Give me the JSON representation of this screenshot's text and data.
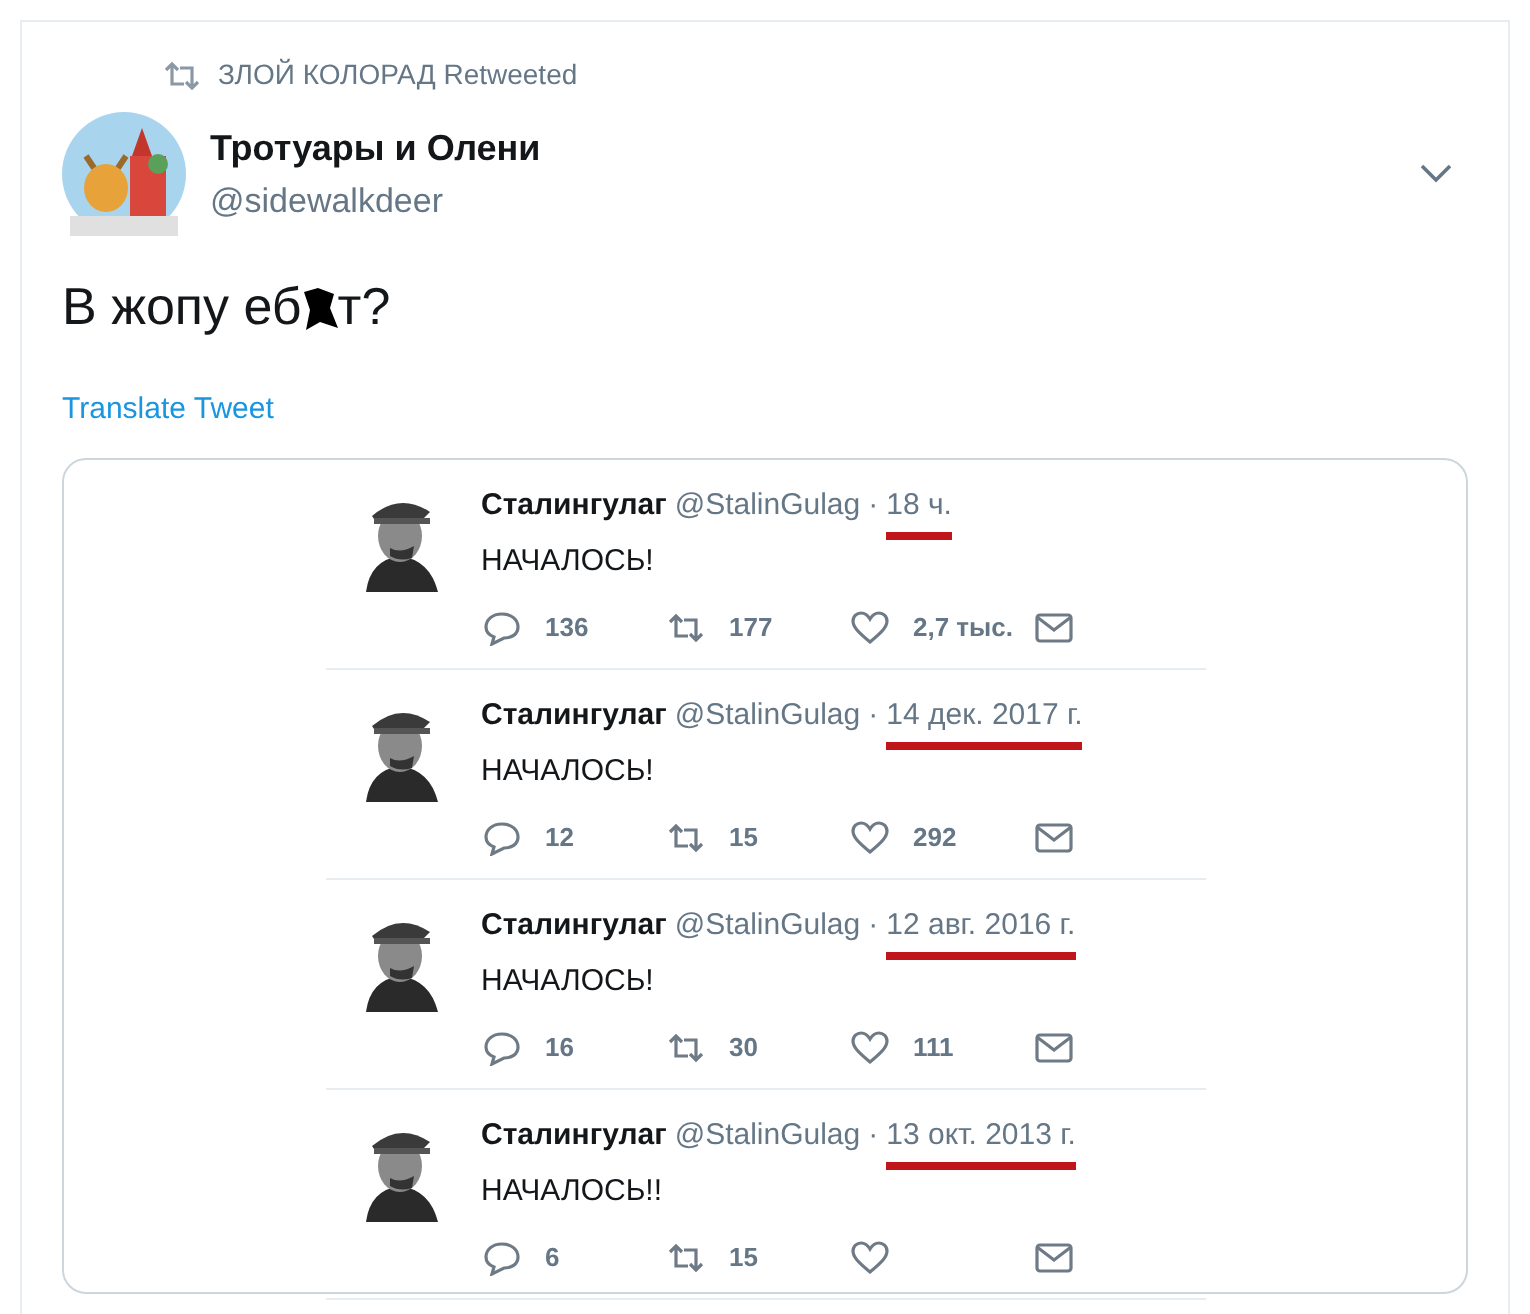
{
  "retweet_banner": {
    "text": "ЗЛОЙ КОЛОРАД Retweeted"
  },
  "author": {
    "name": "Тротуары и Олени",
    "handle": "@sidewalkdeer"
  },
  "tweet_text": {
    "before_censor": "В жопу еб",
    "after_censor": "т?"
  },
  "translate_link": "Translate Tweet",
  "quoted_tweets": [
    {
      "name": "Сталингулаг",
      "handle": "@StalinGulag",
      "separator": "·",
      "date": "18 ч.",
      "date_underlined": true,
      "text": "НАЧАЛОСЬ!",
      "replies": "136",
      "retweets": "177",
      "likes": "2,7 тыс."
    },
    {
      "name": "Сталингулаг",
      "handle": "@StalinGulag",
      "separator": "·",
      "date": "14 дек. 2017 г.",
      "date_underlined": true,
      "text": "НАЧАЛОСЬ!",
      "replies": "12",
      "retweets": "15",
      "likes": "292"
    },
    {
      "name": "Сталингулаг",
      "handle": "@StalinGulag",
      "separator": "·",
      "date": "12 авг. 2016 г.",
      "date_underlined": true,
      "text": "НАЧАЛОСЬ!",
      "replies": "16",
      "retweets": "30",
      "likes": "111"
    },
    {
      "name": "Сталингулаг",
      "handle": "@StalinGulag",
      "separator": "·",
      "date": "13 окт. 2013 г.",
      "date_underlined": true,
      "text": "НАЧАЛОСЬ!!",
      "replies": "6",
      "retweets": "15"
    }
  ]
}
